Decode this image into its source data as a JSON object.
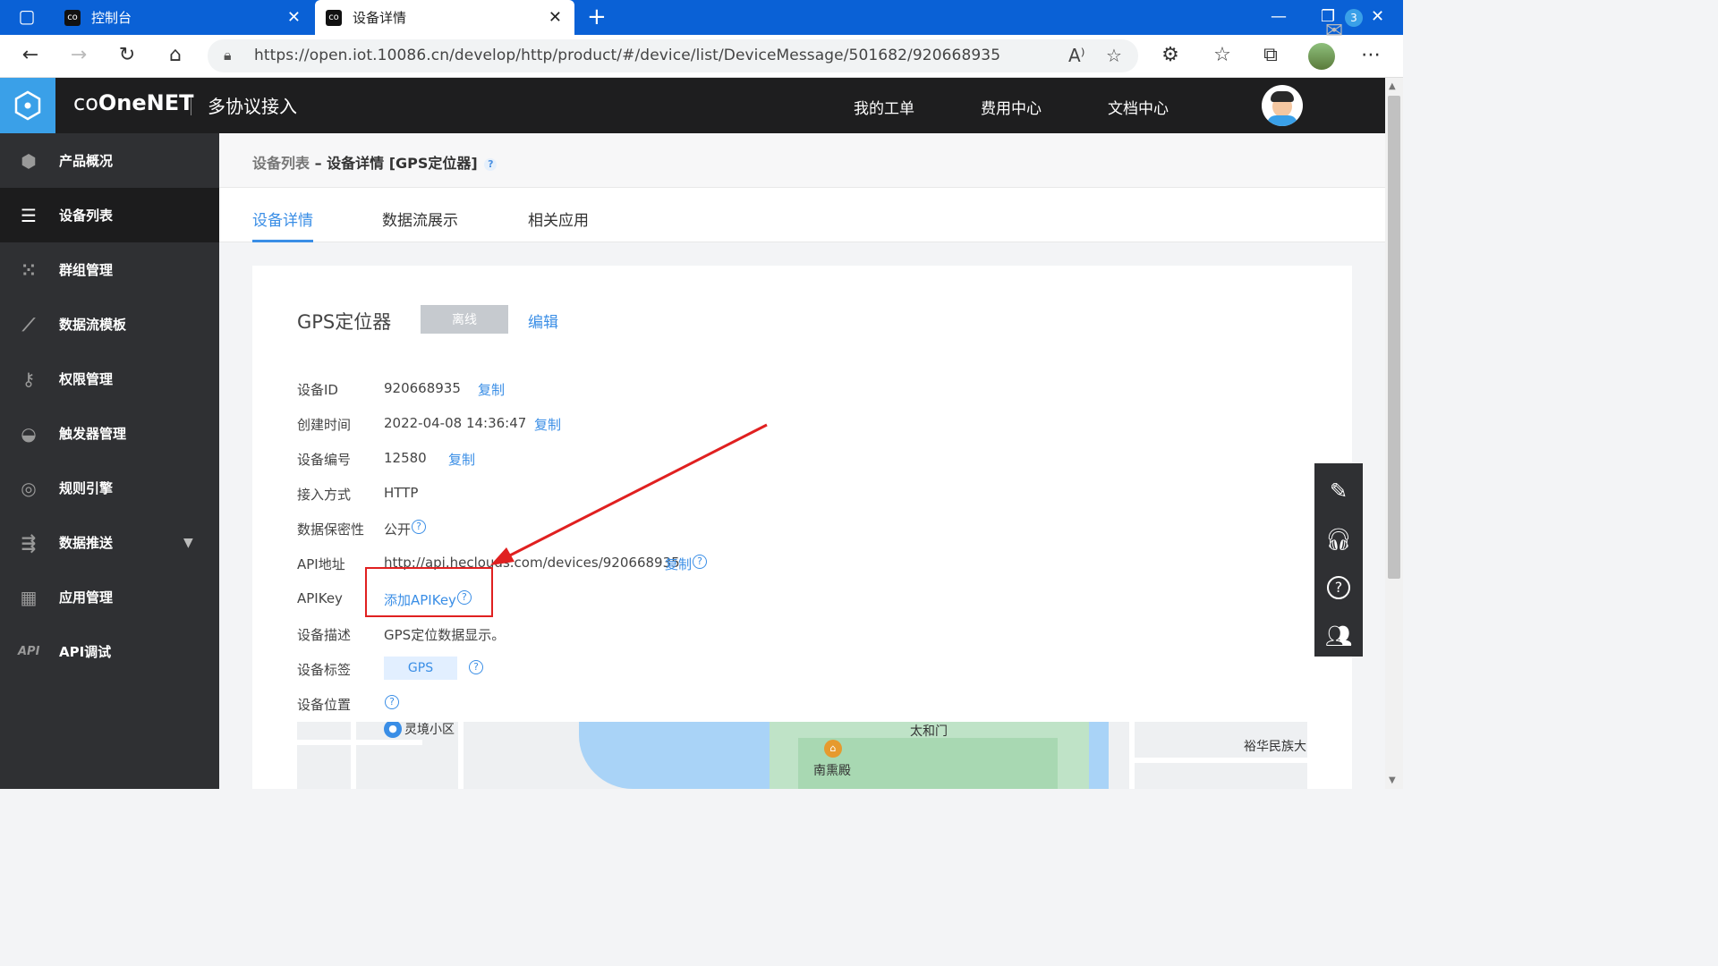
{
  "browser": {
    "tabs": [
      {
        "title": "控制台",
        "favicon": "onenet-favicon"
      },
      {
        "title": "设备详情",
        "favicon": "onenet-favicon"
      }
    ],
    "url": "https://open.iot.10086.cn/develop/http/product/#/device/list/DeviceMessage/501682/920668935"
  },
  "header": {
    "brand": "OneNET",
    "product": "多协议接入",
    "nav": [
      "我的工单",
      "费用中心",
      "文档中心"
    ],
    "mail_badge": "3"
  },
  "sidebar": {
    "items": [
      {
        "label": "产品概况",
        "icon": "cube-icon"
      },
      {
        "label": "设备列表",
        "icon": "list-icon"
      },
      {
        "label": "群组管理",
        "icon": "grid-dots-icon"
      },
      {
        "label": "数据流模板",
        "icon": "line-chart-icon"
      },
      {
        "label": "权限管理",
        "icon": "key-icon"
      },
      {
        "label": "触发器管理",
        "icon": "trigger-icon"
      },
      {
        "label": "规则引擎",
        "icon": "target-icon"
      },
      {
        "label": "数据推送",
        "icon": "push-icon"
      },
      {
        "label": "应用管理",
        "icon": "apps-icon"
      },
      {
        "label": "API调试",
        "icon": "api-icon"
      }
    ],
    "active_index": 1
  },
  "breadcrumb": {
    "parent": "设备列表",
    "separator": " – ",
    "current": "设备详情 [GPS定位器]",
    "help": "?"
  },
  "page_tabs": [
    "设备详情",
    "数据流展示",
    "相关应用"
  ],
  "device": {
    "name": "GPS定位器",
    "status": "离线",
    "edit_label": "编辑",
    "fields": {
      "id": {
        "label": "设备ID",
        "value": "920668935",
        "action": "复制"
      },
      "created": {
        "label": "创建时间",
        "value": "2022-04-08 14:36:47",
        "action": "复制"
      },
      "number": {
        "label": "设备编号",
        "value": "12580",
        "action": "复制"
      },
      "access": {
        "label": "接入方式",
        "value": "HTTP"
      },
      "privacy": {
        "label": "数据保密性",
        "value": "公开"
      },
      "api": {
        "label": "API地址",
        "value": "http://api.heclouds.com/devices/920668935",
        "action": "复制"
      },
      "apikey": {
        "label": "APIKey",
        "action": "添加APIKey"
      },
      "desc": {
        "label": "设备描述",
        "value": "GPS定位数据显示。"
      },
      "tags": {
        "label": "设备标签",
        "values": [
          "GPS"
        ]
      },
      "location": {
        "label": "设备位置"
      }
    }
  },
  "map": {
    "labels": [
      "灵境小区",
      "太和门",
      "南熏殿",
      "裕华民族大"
    ]
  },
  "float_tools": [
    "edit-icon",
    "headset-icon",
    "help-icon",
    "users-icon"
  ],
  "colors": {
    "accent": "#3a8ee6",
    "header_bg": "#1e1e1f",
    "sidebar_bg": "#2f3033",
    "logo_bg": "#3aa0e8",
    "annotation_red": "#e02020"
  }
}
